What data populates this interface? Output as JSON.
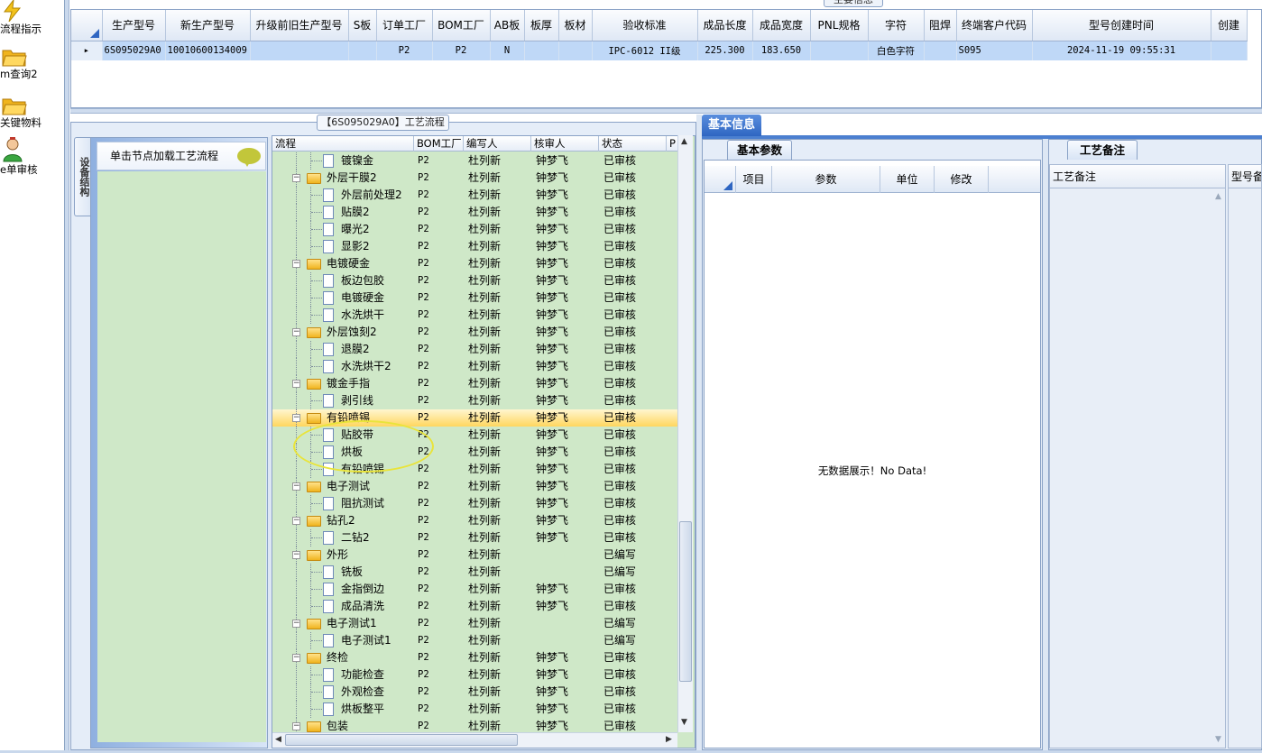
{
  "left_nav": [
    {
      "label": "流程指示",
      "icon": "lightning-icon"
    },
    {
      "label": "m查询2",
      "icon": "folder-icon"
    },
    {
      "label": "关键物料",
      "icon": "folder-icon"
    },
    {
      "label": "e单审核",
      "icon": "user-icon"
    }
  ],
  "top_panel": {
    "tab_label": "主要信息",
    "columns": [
      "生产型号",
      "新生产型号",
      "升级前旧生产型号",
      "S板",
      "订单工厂",
      "BOM工厂",
      "AB板",
      "板厚",
      "板材",
      "验收标准",
      "成品长度",
      "成品宽度",
      "PNL规格",
      "字符",
      "阻焊",
      "终端客户代码",
      "型号创建时间",
      "创建"
    ],
    "row": [
      "6S095029A0",
      "10010600134009",
      "",
      "",
      "P2",
      "P2",
      "N",
      "",
      "",
      "IPC-6012 II级",
      "225.300",
      "183.650",
      "",
      "白色字符",
      "",
      "S095",
      "2024-11-19 09:55:31",
      ""
    ]
  },
  "process_panel": {
    "tab_label": "【6S095029A0】工艺流程",
    "side_tab_label": "设备结构",
    "node_hint": "单击节点加载工艺流程",
    "tree_columns": [
      "流程",
      "BOM工厂",
      "编写人",
      "核审人",
      "状态",
      "P"
    ],
    "rows": [
      {
        "level": 2,
        "name": "镀镍金",
        "bom": "P2",
        "writer": "杜列新",
        "reviewer": "钟梦飞",
        "status": "已审核"
      },
      {
        "level": 1,
        "name": "外层干膜2",
        "bom": "P2",
        "writer": "杜列新",
        "reviewer": "钟梦飞",
        "status": "已审核"
      },
      {
        "level": 2,
        "name": "外层前处理2",
        "bom": "P2",
        "writer": "杜列新",
        "reviewer": "钟梦飞",
        "status": "已审核"
      },
      {
        "level": 2,
        "name": "贴膜2",
        "bom": "P2",
        "writer": "杜列新",
        "reviewer": "钟梦飞",
        "status": "已审核"
      },
      {
        "level": 2,
        "name": "曝光2",
        "bom": "P2",
        "writer": "杜列新",
        "reviewer": "钟梦飞",
        "status": "已审核"
      },
      {
        "level": 2,
        "name": "显影2",
        "bom": "P2",
        "writer": "杜列新",
        "reviewer": "钟梦飞",
        "status": "已审核"
      },
      {
        "level": 1,
        "name": "电镀硬金",
        "bom": "P2",
        "writer": "杜列新",
        "reviewer": "钟梦飞",
        "status": "已审核"
      },
      {
        "level": 2,
        "name": "板边包胶",
        "bom": "P2",
        "writer": "杜列新",
        "reviewer": "钟梦飞",
        "status": "已审核"
      },
      {
        "level": 2,
        "name": "电镀硬金",
        "bom": "P2",
        "writer": "杜列新",
        "reviewer": "钟梦飞",
        "status": "已审核"
      },
      {
        "level": 2,
        "name": "水洗烘干",
        "bom": "P2",
        "writer": "杜列新",
        "reviewer": "钟梦飞",
        "status": "已审核"
      },
      {
        "level": 1,
        "name": "外层蚀刻2",
        "bom": "P2",
        "writer": "杜列新",
        "reviewer": "钟梦飞",
        "status": "已审核"
      },
      {
        "level": 2,
        "name": "退膜2",
        "bom": "P2",
        "writer": "杜列新",
        "reviewer": "钟梦飞",
        "status": "已审核"
      },
      {
        "level": 2,
        "name": "水洗烘干2",
        "bom": "P2",
        "writer": "杜列新",
        "reviewer": "钟梦飞",
        "status": "已审核"
      },
      {
        "level": 1,
        "name": "镀金手指",
        "bom": "P2",
        "writer": "杜列新",
        "reviewer": "钟梦飞",
        "status": "已审核"
      },
      {
        "level": 2,
        "name": "剥引线",
        "bom": "P2",
        "writer": "杜列新",
        "reviewer": "钟梦飞",
        "status": "已审核"
      },
      {
        "level": 1,
        "name": "有铅喷锡",
        "bom": "P2",
        "writer": "杜列新",
        "reviewer": "钟梦飞",
        "status": "已审核",
        "selected": true
      },
      {
        "level": 2,
        "name": "贴胶带",
        "bom": "P2",
        "writer": "杜列新",
        "reviewer": "钟梦飞",
        "status": "已审核"
      },
      {
        "level": 2,
        "name": "烘板",
        "bom": "P2",
        "writer": "杜列新",
        "reviewer": "钟梦飞",
        "status": "已审核"
      },
      {
        "level": 2,
        "name": "有铅喷锡",
        "bom": "P2",
        "writer": "杜列新",
        "reviewer": "钟梦飞",
        "status": "已审核"
      },
      {
        "level": 1,
        "name": "电子测试",
        "bom": "P2",
        "writer": "杜列新",
        "reviewer": "钟梦飞",
        "status": "已审核"
      },
      {
        "level": 2,
        "name": "阻抗测试",
        "bom": "P2",
        "writer": "杜列新",
        "reviewer": "钟梦飞",
        "status": "已审核"
      },
      {
        "level": 1,
        "name": "钻孔2",
        "bom": "P2",
        "writer": "杜列新",
        "reviewer": "钟梦飞",
        "status": "已审核"
      },
      {
        "level": 2,
        "name": "二钻2",
        "bom": "P2",
        "writer": "杜列新",
        "reviewer": "钟梦飞",
        "status": "已审核"
      },
      {
        "level": 1,
        "name": "外形",
        "bom": "P2",
        "writer": "杜列新",
        "reviewer": "",
        "status": "已编写"
      },
      {
        "level": 2,
        "name": "铣板",
        "bom": "P2",
        "writer": "杜列新",
        "reviewer": "",
        "status": "已编写"
      },
      {
        "level": 2,
        "name": "金指倒边",
        "bom": "P2",
        "writer": "杜列新",
        "reviewer": "钟梦飞",
        "status": "已审核"
      },
      {
        "level": 2,
        "name": "成品清洗",
        "bom": "P2",
        "writer": "杜列新",
        "reviewer": "钟梦飞",
        "status": "已审核"
      },
      {
        "level": 1,
        "name": "电子测试1",
        "bom": "P2",
        "writer": "杜列新",
        "reviewer": "",
        "status": "已编写"
      },
      {
        "level": 2,
        "name": "电子测试1",
        "bom": "P2",
        "writer": "杜列新",
        "reviewer": "",
        "status": "已编写"
      },
      {
        "level": 1,
        "name": "终检",
        "bom": "P2",
        "writer": "杜列新",
        "reviewer": "钟梦飞",
        "status": "已审核"
      },
      {
        "level": 2,
        "name": "功能检查",
        "bom": "P2",
        "writer": "杜列新",
        "reviewer": "钟梦飞",
        "status": "已审核"
      },
      {
        "level": 2,
        "name": "外观检查",
        "bom": "P2",
        "writer": "杜列新",
        "reviewer": "钟梦飞",
        "status": "已审核"
      },
      {
        "level": 2,
        "name": "烘板整平",
        "bom": "P2",
        "writer": "杜列新",
        "reviewer": "钟梦飞",
        "status": "已审核"
      },
      {
        "level": 1,
        "name": "包装",
        "bom": "P2",
        "writer": "杜列新",
        "reviewer": "钟梦飞",
        "status": "已审核"
      }
    ]
  },
  "basic_info": {
    "tab_label": "基本信息",
    "params_tab_label": "基本参数",
    "params_columns": [
      "项目",
      "参数",
      "单位",
      "修改"
    ],
    "empty_text": "无数据展示！No Data!"
  },
  "remarks": {
    "tab_label": "工艺备注",
    "columns": [
      "工艺备注",
      "型号备"
    ]
  },
  "colors": {
    "selection": "#bfd8f7",
    "tree_bg": "#cfe8c8",
    "highlight_row": "#ffd65e",
    "annotation_ellipse": "#e9e43a",
    "tab_active": "#2f66c2"
  }
}
